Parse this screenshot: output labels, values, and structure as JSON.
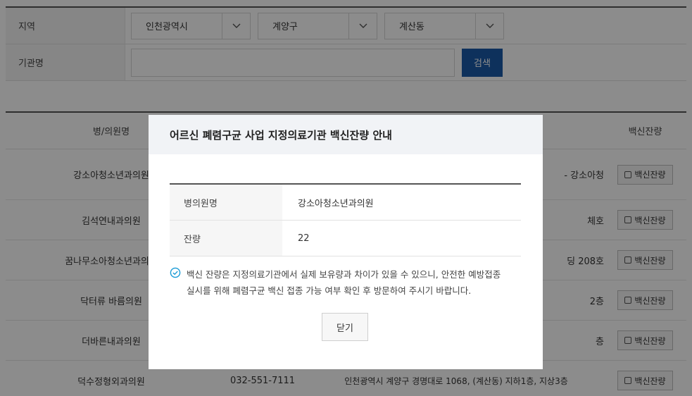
{
  "filter": {
    "region_label": "지역",
    "province": "인천광역시",
    "district": "계양구",
    "dong": "계산동",
    "institution_label": "기관명",
    "institution_value": "",
    "search_label": "검색"
  },
  "table": {
    "headers": [
      "병/의원명",
      "",
      "",
      "백신잔량"
    ],
    "rows": [
      {
        "name": "강소아청소년과의원",
        "phone": "",
        "address": "- 강소아청",
        "action": "백신잔량"
      },
      {
        "name": "김석연내과의원",
        "phone": "",
        "address": "체호",
        "action": "백신잔량"
      },
      {
        "name": "꿈나무소아청소년과의원",
        "phone": "",
        "address": "딩 208호",
        "action": "백신잔량"
      },
      {
        "name": "닥터류 바름의원",
        "phone": "",
        "address": "2층",
        "action": "백신잔량"
      },
      {
        "name": "더바른내과의원",
        "phone": "",
        "address": "층",
        "action": "백신잔량"
      },
      {
        "name": "덕수정형외과의원",
        "phone": "032-551-7111",
        "address": "인천광역시 계양구 경명대로 1068, (계산동) 지하1층, 지상3층",
        "action": "백신잔량"
      }
    ]
  },
  "modal": {
    "title": "어르신 폐렴구균 사업 지정의료기관 백신잔량 안내",
    "rows": [
      {
        "label": "병의원명",
        "value": "강소아청소년과의원"
      },
      {
        "label": "잔량",
        "value": "22"
      }
    ],
    "notice_line1": "백신 잔량은 지정의료기관에서 실제 보유량과 차이가 있을 수 있으니, 안전한 예방접종",
    "notice_line2": "실시를 위해 폐렴구균 백신 접종 가능 여부 확인 후 방문하여 주시기 바랍니다.",
    "close_label": "닫기",
    "accent_color": "#1a9bd6"
  }
}
